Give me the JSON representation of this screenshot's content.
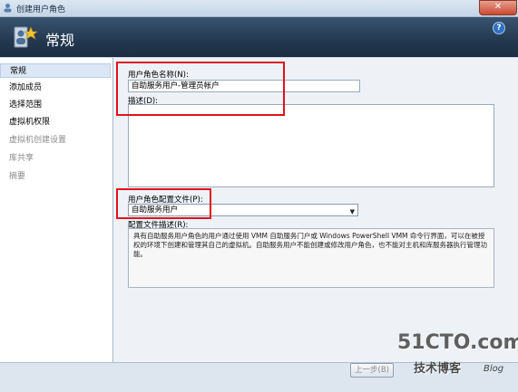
{
  "window": {
    "title": "创建用户角色",
    "close_glyph": "✕"
  },
  "banner": {
    "title": "常规",
    "help_glyph": "?"
  },
  "sidebar": {
    "items": [
      {
        "label": "常规",
        "state": "active"
      },
      {
        "label": "添加成员",
        "state": "normal"
      },
      {
        "label": "选择范围",
        "state": "normal"
      },
      {
        "label": "虚拟机权限",
        "state": "normal"
      },
      {
        "label": "虚拟机创建设置",
        "state": "disabled"
      },
      {
        "label": "库共享",
        "state": "disabled"
      },
      {
        "label": "摘要",
        "state": "disabled"
      }
    ]
  },
  "form": {
    "name_label": "用户角色名称(N):",
    "name_value": "自助服务用户-管理员帐户",
    "description_label": "描述(D):",
    "description_value": "",
    "profile_label": "用户角色配置文件(P):",
    "profile_value": "自助服务用户",
    "profile_desc_label": "配置文件描述(R):",
    "profile_desc_text": "具有自助服务用户角色的用户通过使用 VMM 自助服务门户或 Windows PowerShell VMM 命令行界面，可以在被授权的环境下创建和管理其自己的虚拟机。自助服务用户不能创建或修改用户角色，也不能对主机和库服务器执行管理功能。"
  },
  "footer": {
    "back_label": "上一步(B)"
  },
  "watermark": {
    "site": "51CTO.com",
    "tagline": "技术博客",
    "blog": "Blog"
  },
  "colors": {
    "highlight": "#e0121c",
    "banner": "#23384f",
    "active_nav": "#dbe7f5"
  },
  "icons": {
    "app": "role-icon",
    "banner": "users-role-icon",
    "help": "help-icon",
    "dropdown": "dropdown-arrow-icon"
  }
}
